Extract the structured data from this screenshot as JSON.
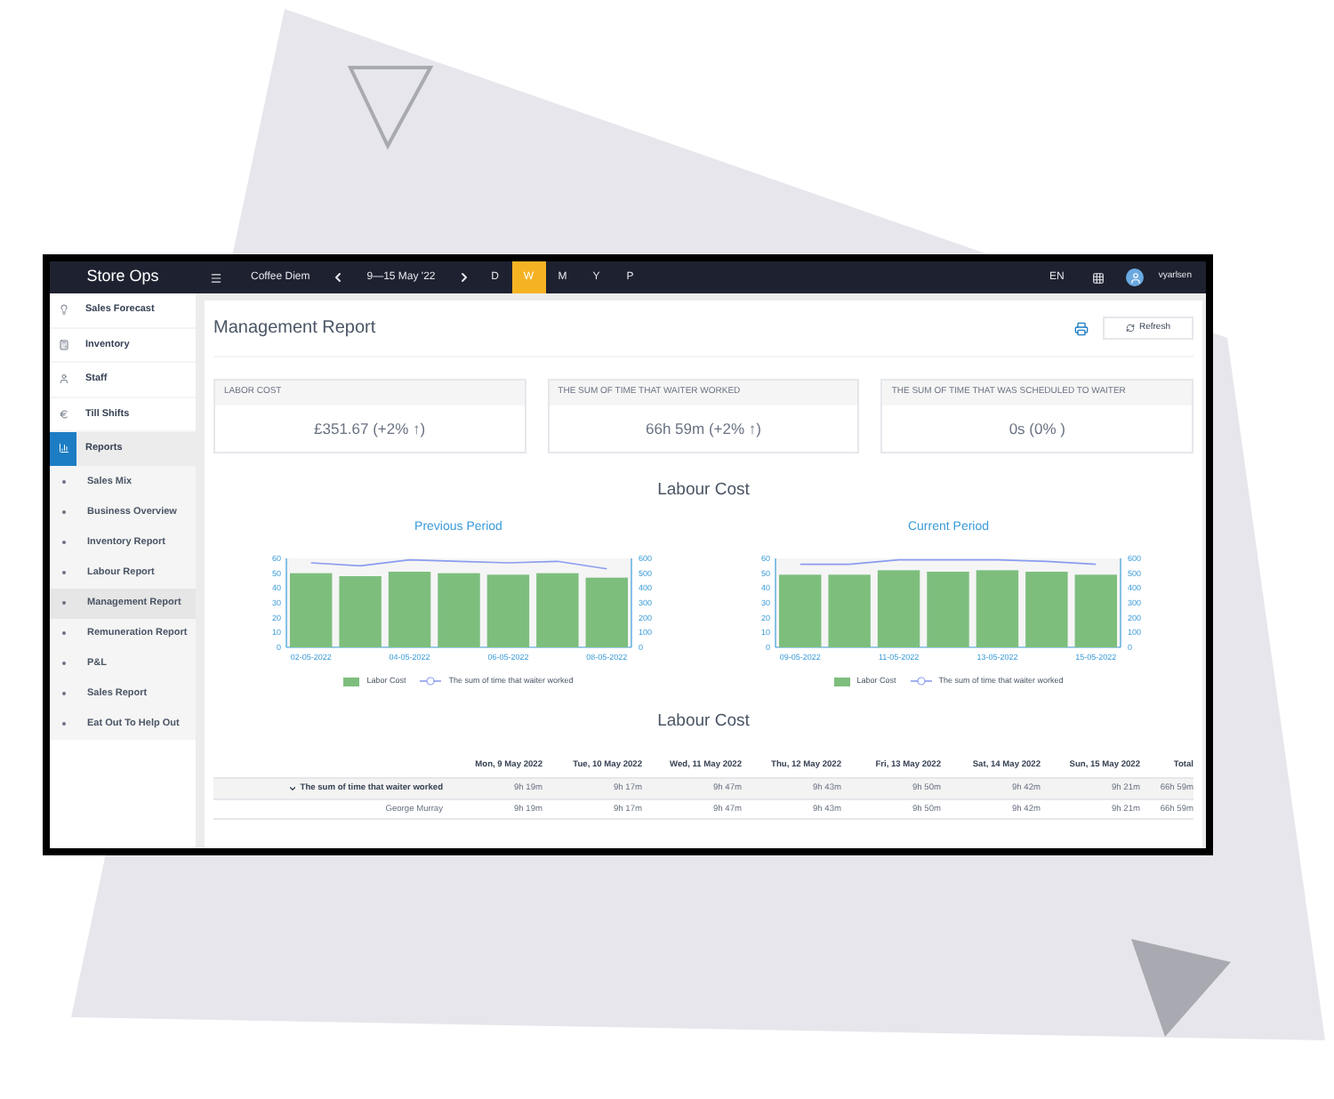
{
  "topbar": {
    "title": "Store Ops",
    "store": "Coffee Diem",
    "date_range": "9—15 May '22",
    "periods": [
      {
        "label": "D",
        "selected": false
      },
      {
        "label": "W",
        "selected": true
      },
      {
        "label": "M",
        "selected": false
      },
      {
        "label": "Y",
        "selected": false
      },
      {
        "label": "P",
        "selected": false
      }
    ],
    "language": "EN",
    "user": "vyarlsen"
  },
  "sidebar": {
    "items": [
      {
        "label": "Sales Forecast",
        "kind": "bulb",
        "selected": false
      },
      {
        "label": "Inventory",
        "kind": "calculator",
        "selected": false
      },
      {
        "label": "Staff",
        "kind": "person",
        "selected": false
      },
      {
        "label": "Till Shifts",
        "kind": "euro",
        "selected": false
      },
      {
        "label": "Reports",
        "kind": "chart",
        "selected": true
      }
    ],
    "subitems": [
      {
        "label": "Sales Mix",
        "selected": false
      },
      {
        "label": "Business Overview",
        "selected": false
      },
      {
        "label": "Inventory Report",
        "selected": false
      },
      {
        "label": "Labour Report",
        "selected": false
      },
      {
        "label": "Management Report",
        "selected": true
      },
      {
        "label": "Remuneration Report",
        "selected": false
      },
      {
        "label": "P&L",
        "selected": false
      },
      {
        "label": "Sales Report",
        "selected": false
      },
      {
        "label": "Eat Out To Help Out",
        "selected": false
      }
    ]
  },
  "page": {
    "title": "Management Report",
    "refresh": "Refresh"
  },
  "cards": [
    {
      "title": "LABOR COST",
      "value": "£351.67 (+2% ↑)"
    },
    {
      "title": "THE SUM OF TIME THAT WAITER WORKED",
      "value": "66h 59m (+2% ↑)"
    },
    {
      "title": "THE SUM OF TIME THAT WAS SCHEDULED TO WAITER",
      "value": "0s (0% )"
    }
  ],
  "charts_title": "Labour Cost",
  "charts": [
    {
      "title": "Previous Period",
      "chart_data": {
        "type": "bar",
        "categories": [
          "02-05-2022",
          null,
          "04-05-2022",
          null,
          "06-05-2022",
          null,
          "08-05-2022"
        ],
        "stacked": false,
        "ylim": [
          0,
          60
        ],
        "yticks": [
          0,
          10,
          20,
          30,
          40,
          50,
          60
        ],
        "y2lim": [
          0,
          600
        ],
        "y2ticks": [
          0,
          100,
          200,
          300,
          400,
          500,
          600
        ],
        "series": [
          {
            "name": "Labor Cost",
            "color": "#7dbe7d",
            "type": "bar",
            "values": [
              50,
              48,
              51,
              50,
              49,
              50,
              47
            ]
          },
          {
            "name": "The sum of time that waiter worked",
            "color": "#8b9cf0",
            "type": "line",
            "axis": "y2",
            "values": [
              570,
              550,
              590,
              580,
              570,
              580,
              530
            ]
          }
        ]
      }
    },
    {
      "title": "Current Period",
      "chart_data": {
        "type": "bar",
        "categories": [
          "09-05-2022",
          null,
          "11-05-2022",
          null,
          "13-05-2022",
          null,
          "15-05-2022"
        ],
        "stacked": false,
        "ylim": [
          0,
          60
        ],
        "yticks": [
          0,
          10,
          20,
          30,
          40,
          50,
          60
        ],
        "y2lim": [
          0,
          600
        ],
        "y2ticks": [
          0,
          100,
          200,
          300,
          400,
          500,
          600
        ],
        "series": [
          {
            "name": "Labor Cost",
            "color": "#7dbe7d",
            "type": "bar",
            "values": [
              49,
              49,
              52,
              51,
              52,
              51,
              49
            ]
          },
          {
            "name": "The sum of time that waiter worked",
            "color": "#8b9cf0",
            "type": "line",
            "axis": "y2",
            "values": [
              560,
              560,
              590,
              590,
              590,
              580,
              560
            ]
          }
        ]
      }
    }
  ],
  "table": {
    "title": "Labour Cost",
    "columns": [
      "Mon, 9 May 2022",
      "Tue, 10 May 2022",
      "Wed, 11 May 2022",
      "Thu, 12 May 2022",
      "Fri, 13 May 2022",
      "Sat, 14 May 2022",
      "Sun, 15 May 2022",
      "Total"
    ],
    "rows": [
      {
        "label": "The sum of time that waiter worked",
        "expanded": true,
        "cells": [
          "9h 19m",
          "9h 17m",
          "9h 47m",
          "9h 43m",
          "9h 50m",
          "9h 42m",
          "9h 21m",
          "66h 59m"
        ],
        "children": [
          {
            "label": "George Murray",
            "cells": [
              "9h 19m",
              "9h 17m",
              "9h 47m",
              "9h 43m",
              "9h 50m",
              "9h 42m",
              "9h 21m",
              "66h 59m"
            ]
          }
        ]
      }
    ]
  }
}
